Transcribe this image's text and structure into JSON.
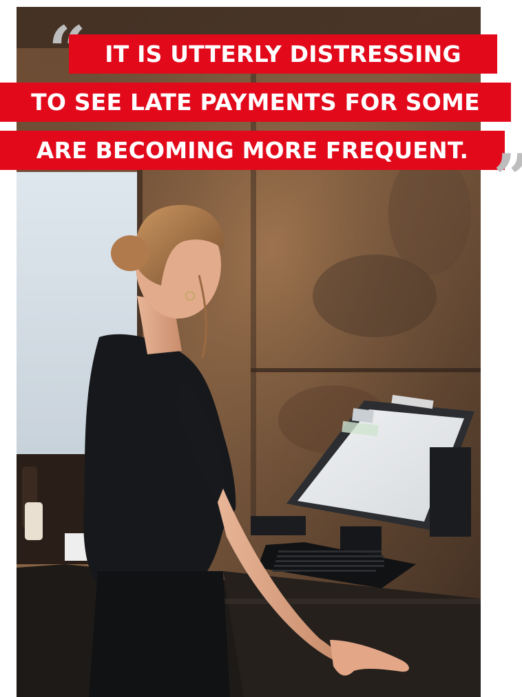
{
  "quote": {
    "line1": "IT IS UTTERLY DISTRESSING",
    "line2": "TO SEE LATE PAYMENTS FOR SOME",
    "line3": "ARE BECOMING MORE FREQUENT."
  },
  "colors": {
    "band": "#e2091b",
    "quote_marks": "#bdbdbd",
    "text": "#ffffff"
  },
  "icons": {
    "open": "open-quote-icon",
    "close": "close-quote-icon"
  }
}
